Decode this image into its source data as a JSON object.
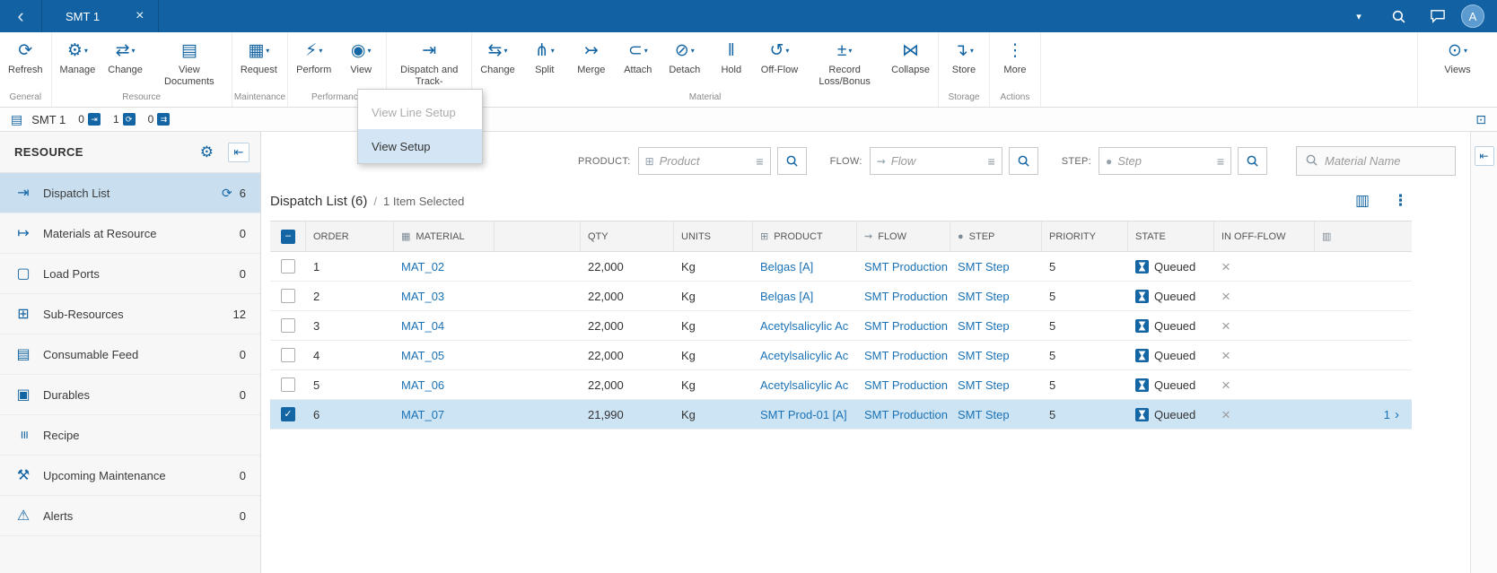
{
  "topbar": {
    "back_icon": "‹",
    "tab": {
      "label": "SMT 1",
      "close_icon": "×"
    },
    "dropdown_icon": "▾",
    "avatar": "A"
  },
  "ribbon": {
    "groups": [
      {
        "label": "General",
        "buttons": [
          {
            "name": "refresh",
            "label": "Refresh",
            "icon": "⟳",
            "caret": false
          }
        ]
      },
      {
        "label": "Resource",
        "buttons": [
          {
            "name": "manage",
            "label": "Manage",
            "icon": "⚙",
            "caret": true
          },
          {
            "name": "change-resource",
            "label": "Change",
            "icon": "⇄",
            "caret": true
          },
          {
            "name": "view-documents",
            "label": "View Documents",
            "icon": "▤",
            "caret": false
          }
        ]
      },
      {
        "label": "Maintenance",
        "buttons": [
          {
            "name": "request",
            "label": "Request",
            "icon": "▦",
            "caret": true
          }
        ]
      },
      {
        "label": "Performance",
        "buttons": [
          {
            "name": "perform",
            "label": "Perform",
            "icon": "⚡",
            "caret": true
          },
          {
            "name": "view",
            "label": "View",
            "icon": "◉",
            "caret": true
          }
        ]
      },
      {
        "label": "",
        "buttons": [
          {
            "name": "dispatch-and-track",
            "label": "Dispatch and Track-",
            "icon": "⇥",
            "caret": false
          }
        ]
      },
      {
        "label": "Material",
        "buttons": [
          {
            "name": "change-material",
            "label": "Change",
            "icon": "⇆",
            "caret": true
          },
          {
            "name": "split",
            "label": "Split",
            "icon": "⋔",
            "caret": true
          },
          {
            "name": "merge",
            "label": "Merge",
            "icon": "↣",
            "caret": false
          },
          {
            "name": "attach",
            "label": "Attach",
            "icon": "⊂",
            "caret": true
          },
          {
            "name": "detach",
            "label": "Detach",
            "icon": "⊘",
            "caret": true
          },
          {
            "name": "hold",
            "label": "Hold",
            "icon": "‖",
            "caret": false
          },
          {
            "name": "off-flow",
            "label": "Off-Flow",
            "icon": "↺",
            "caret": true
          },
          {
            "name": "record-loss-bonus",
            "label": "Record Loss/Bonus",
            "icon": "±",
            "caret": true
          },
          {
            "name": "collapse",
            "label": "Collapse",
            "icon": "⋈",
            "caret": false
          }
        ]
      },
      {
        "label": "Storage",
        "buttons": [
          {
            "name": "store",
            "label": "Store",
            "icon": "↴",
            "caret": true
          }
        ]
      },
      {
        "label": "Actions",
        "buttons": [
          {
            "name": "more",
            "label": "More",
            "icon": "⋮",
            "caret": false
          }
        ]
      }
    ],
    "views_button": {
      "label": "Views",
      "icon": "⊙",
      "caret": "▾"
    }
  },
  "dropdown_menu": {
    "items": [
      {
        "label": "View Line Setup",
        "disabled": true,
        "highlighted": false
      },
      {
        "label": "View Setup",
        "disabled": false,
        "highlighted": true
      }
    ]
  },
  "contextbar": {
    "resource_icon": "▤",
    "resource_label": "SMT 1",
    "counters": [
      {
        "value": "0",
        "icon": "⇥"
      },
      {
        "value": "1",
        "icon": "⟳"
      },
      {
        "value": "0",
        "icon": "⇉"
      }
    ],
    "panel_icon": "⊡"
  },
  "sidebar": {
    "title": "RESOURCE",
    "gear_icon": "⚙",
    "collapse_icon": "⇤",
    "items": [
      {
        "label": "Dispatch List",
        "icon": "⇥",
        "count": "6",
        "selected": true,
        "refresh": true
      },
      {
        "label": "Materials at Resource",
        "icon": "↦",
        "count": "0"
      },
      {
        "label": "Load Ports",
        "icon": "▢",
        "count": "0"
      },
      {
        "label": "Sub-Resources",
        "icon": "⊞",
        "count": "12"
      },
      {
        "label": "Consumable Feed",
        "icon": "▤",
        "count": "0"
      },
      {
        "label": "Durables",
        "icon": "▣",
        "count": "0"
      },
      {
        "label": "Recipe",
        "icon": "≡",
        "count": "",
        "rotate": true
      },
      {
        "label": "Upcoming Maintenance",
        "icon": "⚒",
        "count": "0"
      },
      {
        "label": "Alerts",
        "icon": "⚠",
        "count": "0"
      }
    ]
  },
  "filters": [
    {
      "label": "PRODUCT:",
      "placeholder": "Product",
      "icon": "⊞"
    },
    {
      "label": "FLOW:",
      "placeholder": "Flow",
      "icon": "⇝"
    },
    {
      "label": "STEP:",
      "placeholder": "Step",
      "icon": "●"
    }
  ],
  "filter_options_icon": "≡",
  "material_search": {
    "placeholder": "Material Name"
  },
  "list_header": {
    "title": "Dispatch List (6)",
    "separator": "/",
    "selection": "1 Item Selected",
    "columns_icon": "▥",
    "more_icon": "⋮"
  },
  "table": {
    "columns": [
      {
        "label": "ORDER"
      },
      {
        "label": "MATERIAL",
        "icon": "▦"
      },
      {
        "label": ""
      },
      {
        "label": "QTY"
      },
      {
        "label": "UNITS"
      },
      {
        "label": "PRODUCT",
        "icon": "⊞"
      },
      {
        "label": "FLOW",
        "icon": "⇝"
      },
      {
        "label": "STEP",
        "icon": "●"
      },
      {
        "label": "PRIORITY"
      },
      {
        "label": "STATE"
      },
      {
        "label": "IN OFF-FLOW"
      },
      {
        "label": "",
        "icon": "▥"
      }
    ],
    "rows": [
      {
        "order": "1",
        "material": "MAT_02",
        "qty": "22,000",
        "units": "Kg",
        "product": "Belgas [A]",
        "flow": "SMT Production",
        "step": "SMT Step",
        "priority": "5",
        "state": "Queued",
        "off_flow_icon": "×",
        "detail": "",
        "checked": false,
        "selected": false
      },
      {
        "order": "2",
        "material": "MAT_03",
        "qty": "22,000",
        "units": "Kg",
        "product": "Belgas [A]",
        "flow": "SMT Production",
        "step": "SMT Step",
        "priority": "5",
        "state": "Queued",
        "off_flow_icon": "×",
        "detail": "",
        "checked": false,
        "selected": false
      },
      {
        "order": "3",
        "material": "MAT_04",
        "qty": "22,000",
        "units": "Kg",
        "product": "Acetylsalicylic Ac",
        "flow": "SMT Production",
        "step": "SMT Step",
        "priority": "5",
        "state": "Queued",
        "off_flow_icon": "×",
        "detail": "",
        "checked": false,
        "selected": false
      },
      {
        "order": "4",
        "material": "MAT_05",
        "qty": "22,000",
        "units": "Kg",
        "product": "Acetylsalicylic Ac",
        "flow": "SMT Production",
        "step": "SMT Step",
        "priority": "5",
        "state": "Queued",
        "off_flow_icon": "×",
        "detail": "",
        "checked": false,
        "selected": false
      },
      {
        "order": "5",
        "material": "MAT_06",
        "qty": "22,000",
        "units": "Kg",
        "product": "Acetylsalicylic Ac",
        "flow": "SMT Production",
        "step": "SMT Step",
        "priority": "5",
        "state": "Queued",
        "off_flow_icon": "×",
        "detail": "",
        "checked": false,
        "selected": false
      },
      {
        "order": "6",
        "material": "MAT_07",
        "qty": "21,990",
        "units": "Kg",
        "product": "SMT Prod-01 [A]",
        "flow": "SMT Production",
        "step": "SMT Step",
        "priority": "5",
        "state": "Queued",
        "off_flow_icon": "×",
        "detail": "1",
        "detail_icon": "›",
        "checked": true,
        "selected": true
      }
    ]
  },
  "rail": {
    "expand_icon": "⇤"
  }
}
